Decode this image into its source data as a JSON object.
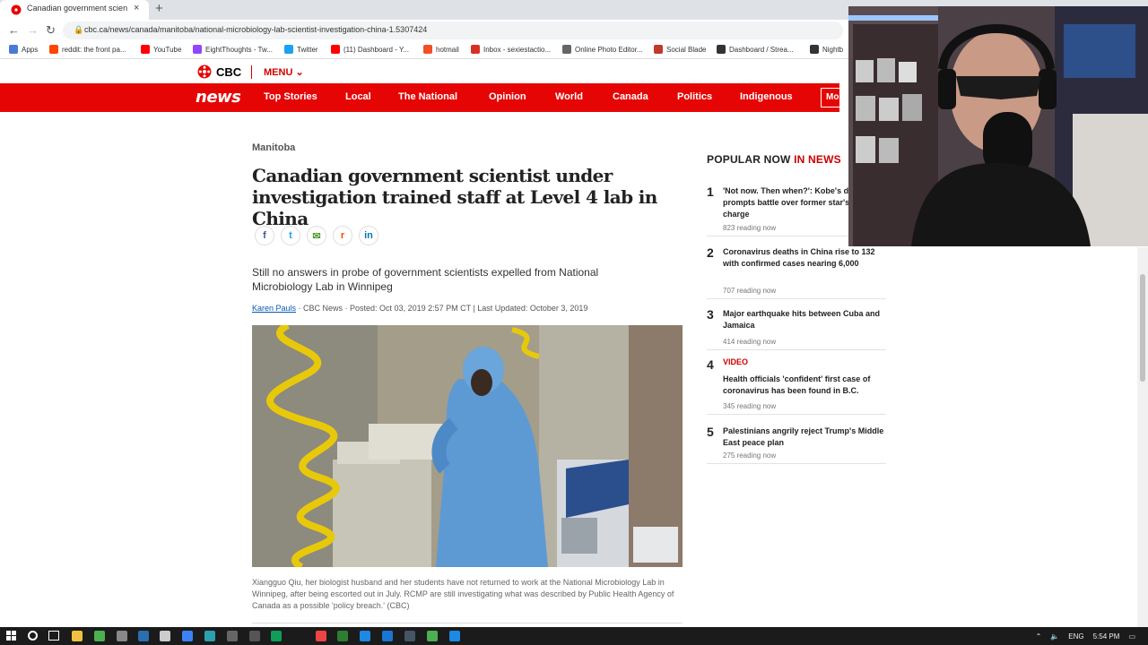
{
  "browser": {
    "tab_title": "Canadian government scientist u",
    "new_tab": "+",
    "close": "×",
    "url": "cbc.ca/news/canada/manitoba/national-microbiology-lab-scientist-investigation-china-1.5307424",
    "bookmarks": [
      {
        "label": "Apps",
        "color": "#4a7bd6"
      },
      {
        "label": "reddit: the front pa...",
        "color": "#ff4500"
      },
      {
        "label": "YouTube",
        "color": "#ff0000"
      },
      {
        "label": "EightThoughts - Tw...",
        "color": "#9146ff"
      },
      {
        "label": "Twitter",
        "color": "#1da1f2"
      },
      {
        "label": "(11) Dashboard - Y...",
        "color": "#ff0000"
      },
      {
        "label": "hotmail",
        "color": "#f25022"
      },
      {
        "label": "Inbox - sexiestactio...",
        "color": "#d93025"
      },
      {
        "label": "Online Photo Editor...",
        "color": "#666666"
      },
      {
        "label": "Social Blade",
        "color": "#c0392b"
      },
      {
        "label": "Dashboard / Strea...",
        "color": "#333333"
      },
      {
        "label": "Nightb",
        "color": "#333333"
      }
    ]
  },
  "cbc": {
    "logo_text": "CBC",
    "menu_label": "MENU ⌄",
    "news_logo": "news",
    "nav": [
      "Top Stories",
      "Local",
      "The National",
      "Opinion",
      "World",
      "Canada",
      "Politics",
      "Indigenous"
    ],
    "more_label": "More"
  },
  "article": {
    "section": "Manitoba",
    "headline": "Canadian government scientist under investigation trained staff at Level 4 lab in China",
    "deck": "Still no answers in probe of government scientists expelled from National Microbiology Lab in Winnipeg",
    "author": "Karen Pauls",
    "byline_rest": " · CBC News · Posted: Oct 03, 2019 2:57 PM CT | Last Updated: October 3, 2019",
    "caption": "Xiangguo Qiu, her biologist husband and her students have not returned to work at the National Microbiology Lab in Winnipeg, after being escorted out in July. RCMP are still investigating what was described by Public Health Agency of Canada as a possible 'policy breach.' (CBC)",
    "share": [
      {
        "icon": "facebook-icon",
        "glyph": "f",
        "color": "#3b5998"
      },
      {
        "icon": "twitter-icon",
        "glyph": "t",
        "color": "#1da1f2"
      },
      {
        "icon": "email-icon",
        "glyph": "✉",
        "color": "#4c9a2a"
      },
      {
        "icon": "reddit-icon",
        "glyph": "r",
        "color": "#ff4500"
      },
      {
        "icon": "linkedin-icon",
        "glyph": "in",
        "color": "#0077b5"
      }
    ]
  },
  "popular": {
    "heading": "POPULAR NOW",
    "heading_sub": " IN NEWS",
    "items": [
      {
        "num": "1",
        "tag": "",
        "title": "'Not now. Then when?': Kobe's death prompts battle over former star's rape charge",
        "reading": "823 reading now"
      },
      {
        "num": "2",
        "tag": "",
        "title": "Coronavirus deaths in China rise to 132 with confirmed cases nearing 6,000",
        "reading": "707 reading now"
      },
      {
        "num": "3",
        "tag": "",
        "title": "Major earthquake hits between Cuba and Jamaica",
        "reading": "414 reading now"
      },
      {
        "num": "4",
        "tag": "VIDEO",
        "title": "Health officials 'confident' first case of coronavirus has been found in B.C.",
        "reading": "345 reading now"
      },
      {
        "num": "5",
        "tag": "",
        "title": "Palestinians angrily reject Trump's Middle East peace plan",
        "reading": "275 reading now"
      }
    ]
  },
  "taskbar": {
    "lang": "ENG",
    "time": "5:54 PM"
  }
}
